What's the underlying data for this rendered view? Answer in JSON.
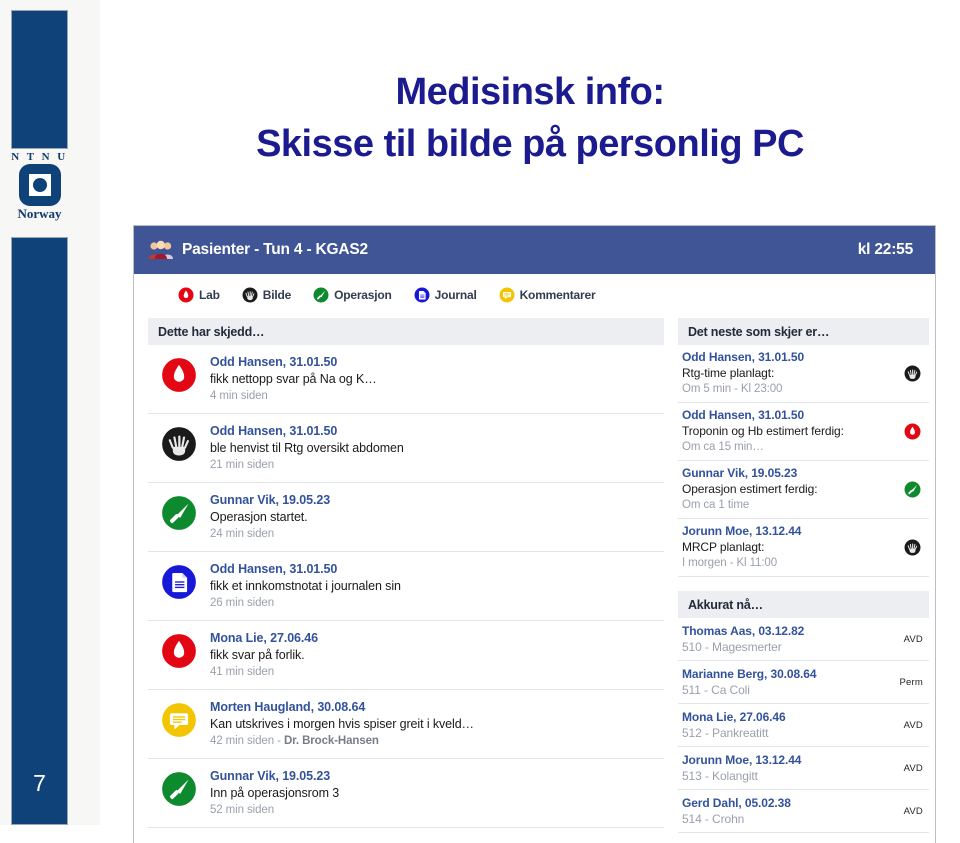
{
  "slide": {
    "title_line1": "Medisinsk info:",
    "title_line2": "Skisse til bilde på personlig PC",
    "page_number": "7",
    "logo": {
      "wordmark": "N T N U",
      "country": "Norway"
    },
    "title_color": "#1b1b8f",
    "brand_color": "#0f4278"
  },
  "app": {
    "header": {
      "title": "Pasienter - Tun 4 - KGAS2",
      "time": "kl 22:55",
      "icon": "people-icon",
      "background": "#3f5596"
    },
    "toolbar": [
      {
        "label": "Lab",
        "icon": "blood-drop-icon",
        "color": "#e30613"
      },
      {
        "label": "Bilde",
        "icon": "xray-hand-icon",
        "color": "#1a1a1a"
      },
      {
        "label": "Operasjon",
        "icon": "scalpel-icon",
        "color": "#0e8a2e"
      },
      {
        "label": "Journal",
        "icon": "document-icon",
        "color": "#1818d8"
      },
      {
        "label": "Kommentarer",
        "icon": "comment-icon",
        "color": "#f2c500"
      }
    ],
    "left_column": {
      "header": "Dette har skjedd…",
      "rows": [
        {
          "icon": "blood-drop-icon",
          "name": "Odd Hansen, 31.01.50",
          "description": "fikk nettopp svar på Na og K…",
          "time": "4 min siden",
          "time_suffix": ""
        },
        {
          "icon": "xray-hand-icon",
          "name": "Odd Hansen, 31.01.50",
          "description": "ble henvist til Rtg oversikt abdomen",
          "time": "21 min siden",
          "time_suffix": ""
        },
        {
          "icon": "scalpel-icon",
          "name": "Gunnar Vik, 19.05.23",
          "description": "Operasjon startet.",
          "time": "24 min siden",
          "time_suffix": ""
        },
        {
          "icon": "document-icon",
          "name": "Odd Hansen, 31.01.50",
          "description": "fikk et innkomstnotat i journalen sin",
          "time": "26 min siden",
          "time_suffix": ""
        },
        {
          "icon": "blood-drop-icon",
          "name": "Mona Lie, 27.06.46",
          "description": "fikk svar på forlik.",
          "time": "41 min siden",
          "time_suffix": ""
        },
        {
          "icon": "comment-icon",
          "name": "Morten Haugland, 30.08.64",
          "description": "Kan utskrives i morgen hvis spiser greit i kveld…",
          "time": "42 min siden - ",
          "time_suffix": "Dr. Brock-Hansen"
        },
        {
          "icon": "scalpel-icon",
          "name": "Gunnar Vik, 19.05.23",
          "description": "Inn på operasjonsrom 3",
          "time": "52 min siden",
          "time_suffix": ""
        }
      ]
    },
    "right_column": {
      "upcoming": {
        "header": "Det neste som skjer er…",
        "rows": [
          {
            "name": "Odd Hansen, 31.01.50",
            "description": "Rtg-time planlagt:",
            "time": "Om 5 min - Kl 23:00",
            "icon": "xray-hand-icon"
          },
          {
            "name": "Odd Hansen, 31.01.50",
            "description": "Troponin og Hb estimert ferdig:",
            "time": "Om ca 15 min…",
            "icon": "blood-drop-icon"
          },
          {
            "name": "Gunnar Vik, 19.05.23",
            "description": "Operasjon estimert ferdig:",
            "time": "Om ca 1 time",
            "icon": "scalpel-icon"
          },
          {
            "name": "Jorunn Moe, 13.12.44",
            "description": "MRCP planlagt:",
            "time": "I morgen - Kl 11:00",
            "icon": "xray-hand-icon"
          }
        ]
      },
      "now": {
        "header": "Akkurat nå…",
        "rows": [
          {
            "name": "Thomas Aas, 03.12.82",
            "info": "510 - Magesmerter",
            "status": "AVD"
          },
          {
            "name": "Marianne Berg, 30.08.64",
            "info": "511 - Ca Coli",
            "status": "Perm"
          },
          {
            "name": "Mona Lie, 27.06.46",
            "info": "512 - Pankreatitt",
            "status": "AVD"
          },
          {
            "name": "Jorunn Moe, 13.12.44",
            "info": "513 - Kolangitt",
            "status": "AVD"
          },
          {
            "name": "Gerd Dahl, 05.02.38",
            "info": "514 - Crohn",
            "status": "AVD"
          }
        ]
      }
    }
  }
}
